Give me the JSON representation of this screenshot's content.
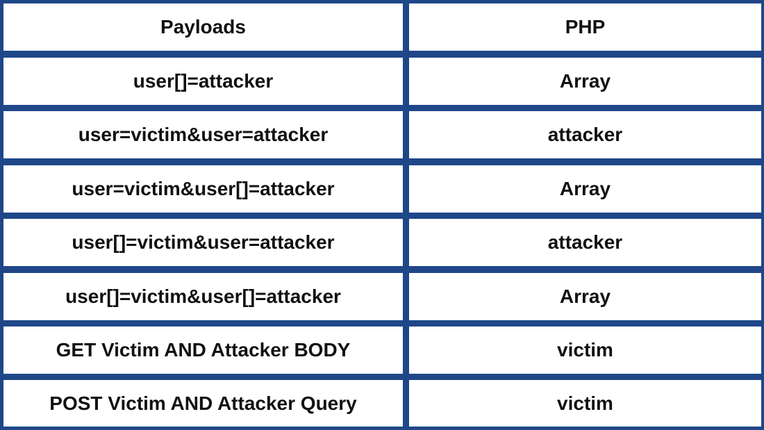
{
  "table": {
    "headers": [
      "Payloads",
      "PHP"
    ],
    "rows": [
      [
        "user[]=attacker",
        "Array"
      ],
      [
        "user=victim&user=attacker",
        "attacker"
      ],
      [
        "user=victim&user[]=attacker",
        "Array"
      ],
      [
        "user[]=victim&user=attacker",
        "attacker"
      ],
      [
        "user[]=victim&user[]=attacker",
        "Array"
      ],
      [
        "GET Victim AND Attacker BODY",
        "victim"
      ],
      [
        "POST Victim AND Attacker Query",
        "victim"
      ]
    ]
  },
  "colors": {
    "border": "#1f4788",
    "cell_background": "#ffffff",
    "text": "#111111"
  }
}
